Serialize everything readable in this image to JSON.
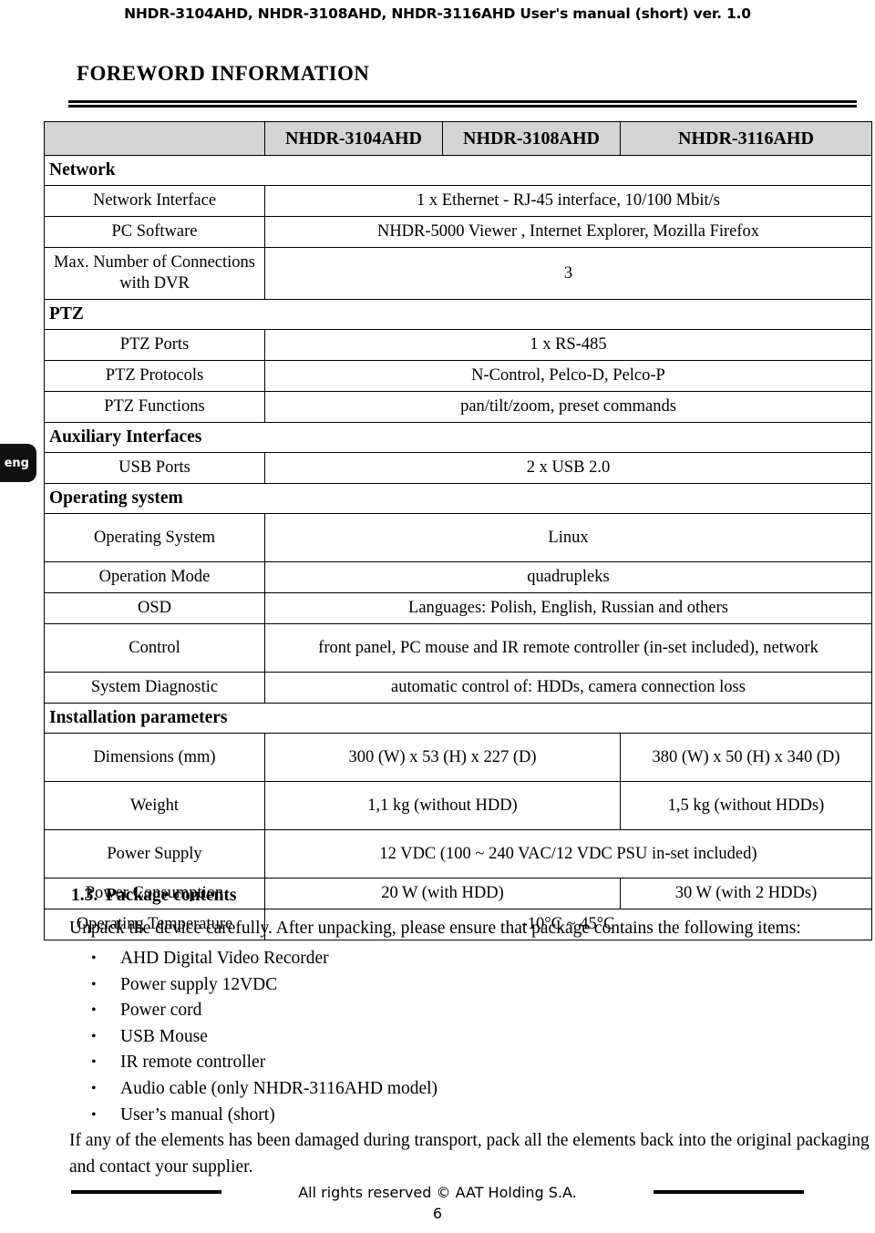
{
  "running_header": "NHDR-3104AHD, NHDR-3108AHD, NHDR-3116AHD User's manual (short) ver. 1.0",
  "section_title": "FOREWORD INFORMATION",
  "side_tab": {
    "label": "eng"
  },
  "spec_table": {
    "header": {
      "blank": "",
      "models": [
        "NHDR-3104AHD",
        "NHDR-3108AHD",
        "NHDR-3116AHD"
      ]
    },
    "groups": [
      {
        "title": "Network",
        "rows": [
          {
            "label": "Network Interface",
            "value": "1 x Ethernet - RJ-45 interface, 10/100 Mbit/s"
          },
          {
            "label": "PC Software",
            "value": "NHDR-5000 Viewer , Internet Explorer, Mozilla Firefox"
          },
          {
            "label": "Max. Number of Connections with DVR",
            "value": "3"
          }
        ]
      },
      {
        "title": "PTZ",
        "rows": [
          {
            "label": "PTZ Ports",
            "value": "1 x RS-485"
          },
          {
            "label": "PTZ Protocols",
            "value": "N-Control, Pelco-D, Pelco-P"
          },
          {
            "label": "PTZ Functions",
            "value": "pan/tilt/zoom, preset commands"
          }
        ]
      },
      {
        "title": "Auxiliary Interfaces",
        "rows": [
          {
            "label": "USB Ports",
            "value": "2 x USB 2.0"
          }
        ]
      },
      {
        "title": "Operating system",
        "rows": [
          {
            "label": "Operating System",
            "value": "Linux"
          },
          {
            "label": "Operation Mode",
            "value": "quadrupleks"
          },
          {
            "label": "OSD",
            "value": "Languages: Polish, English, Russian and others"
          },
          {
            "label": "Control",
            "value": "front panel, PC mouse and IR remote controller (in-set included), network"
          },
          {
            "label": "System Diagnostic",
            "value": "automatic control of: HDDs, camera connection loss"
          }
        ]
      },
      {
        "title": "Installation parameters",
        "rows": [
          {
            "label": "Dimensions (mm)",
            "value_left": "300 (W) x 53 (H) x 227 (D)",
            "value_right": "380 (W) x 50 (H) x 340 (D)"
          },
          {
            "label": "Weight",
            "value_left": "1,1 kg (without HDD)",
            "value_right": "1,5 kg (without HDDs)"
          },
          {
            "label": "Power Supply",
            "value": "12 VDC (100 ~ 240 VAC/12 VDC PSU in-set included)"
          },
          {
            "label": "Power Consumption",
            "value_left": "20 W (with HDD)",
            "value_right": "30 W (with 2 HDDs)"
          },
          {
            "label": "Operating Temperature",
            "value": "-10°C ~ 45°C"
          }
        ]
      }
    ]
  },
  "package": {
    "number": "1.3.",
    "title": "Package contents",
    "intro": "Unpack the device carefully. After unpacking, please ensure that package contains the following items:",
    "items": [
      "AHD Digital Video Recorder",
      "Power supply 12VDC",
      "Power cord",
      "USB Mouse",
      "IR remote controller",
      "Audio cable (only NHDR-3116AHD model)",
      "User’s manual (short)"
    ],
    "outro": "If any of the elements has been damaged during transport, pack all the elements back into the original packaging and contact your supplier."
  },
  "footer": {
    "text": "All rights reserved © AAT Holding S.A.",
    "page_number": "6"
  }
}
